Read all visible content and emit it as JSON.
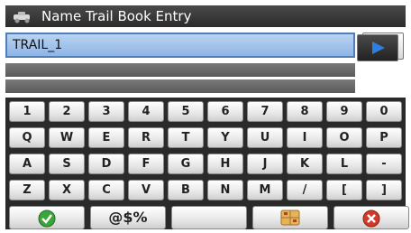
{
  "title": "Name Trail Book Entry",
  "name_field": {
    "value": "TRAIL_1"
  },
  "keyboard": {
    "rows": [
      [
        "1",
        "2",
        "3",
        "4",
        "5",
        "6",
        "7",
        "8",
        "9",
        "0"
      ],
      [
        "Q",
        "W",
        "E",
        "R",
        "T",
        "Y",
        "U",
        "I",
        "O",
        "P"
      ],
      [
        "A",
        "S",
        "D",
        "F",
        "G",
        "H",
        "J",
        "K",
        "L",
        "-"
      ],
      [
        "Z",
        "X",
        "C",
        "V",
        "B",
        "N",
        "M",
        "/",
        "[",
        "]"
      ]
    ],
    "symbols_label": "@$%"
  },
  "icons": {
    "title": "vehicle-icon",
    "backspace": "left-arrow-icon",
    "next": "play-arrow-icon",
    "ok": "checkmark-icon",
    "layout": "keyboard-layout-icon",
    "cancel": "close-x-icon"
  },
  "colors": {
    "title_bar": "#333333",
    "field_fill": "#9dbfe8",
    "field_border": "#4f7fb6",
    "arrow_blue": "#2f7fe0",
    "ok_green": "#3aa63a",
    "cancel_red": "#d23a2a",
    "keyboard_bg": "#2a2a2a"
  }
}
